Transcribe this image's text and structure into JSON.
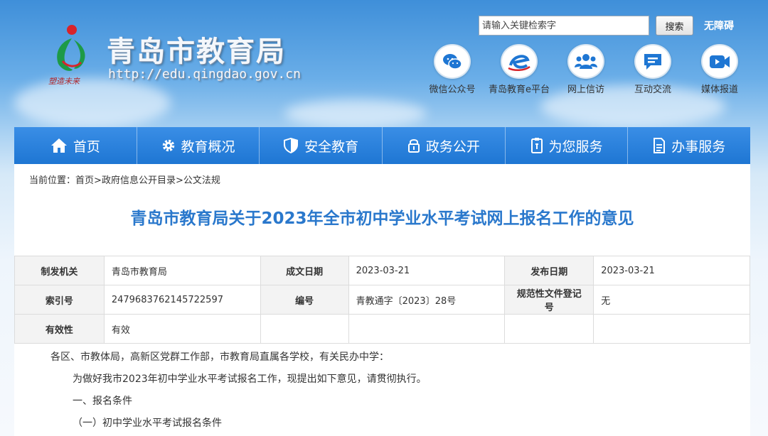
{
  "header": {
    "site_title": "青岛市教育局",
    "site_url": "http://edu.qingdao.gov.cn",
    "logo_caption": "塑造未来",
    "search_placeholder": "请输入关键检索字",
    "search_button": "搜索",
    "accessibility": "无障碍",
    "quick_links": [
      {
        "label": "微信公众号",
        "icon": "wechat-icon"
      },
      {
        "label": "青岛教育e平台",
        "icon": "e-platform-icon"
      },
      {
        "label": "网上信访",
        "icon": "petition-icon"
      },
      {
        "label": "互动交流",
        "icon": "chat-icon"
      },
      {
        "label": "媒体报道",
        "icon": "video-icon"
      }
    ]
  },
  "nav": {
    "items": [
      {
        "label": "首页",
        "icon": "home-icon"
      },
      {
        "label": "教育概况",
        "icon": "gear-icon"
      },
      {
        "label": "安全教育",
        "icon": "shield-icon"
      },
      {
        "label": "政务公开",
        "icon": "lock-icon"
      },
      {
        "label": "为您服务",
        "icon": "document-icon"
      },
      {
        "label": "办事服务",
        "icon": "file-icon"
      }
    ]
  },
  "breadcrumb": {
    "prefix": "当前位置：",
    "items": [
      "首页",
      "政府信息公开目录",
      "公文法规"
    ],
    "separator": ">"
  },
  "document": {
    "title": "青岛市教育局关于2023年全市初中学业水平考试网上报名工作的意见",
    "meta": {
      "issuer_label": "制发机关",
      "issuer": "青岛市教育局",
      "written_date_label": "成文日期",
      "written_date": "2023-03-21",
      "publish_date_label": "发布日期",
      "publish_date": "2023-03-21",
      "index_label": "索引号",
      "index": "2479683762145722597",
      "number_label": "编号",
      "number": "青教通字〔2023〕28号",
      "registration_label": "规范性文件登记号",
      "registration": "无",
      "validity_label": "有效性",
      "validity": "有效"
    },
    "paragraphs": [
      "各区、市教体局，高新区党群工作部，市教育局直属各学校，有关民办中学：",
      "为做好我市2023年初中学业水平考试报名工作，现提出如下意见，请贯彻执行。",
      "一、报名条件",
      "（一）初中学业水平考试报名条件"
    ]
  },
  "colors": {
    "nav_blue": "#1e76d3",
    "title_blue": "#2a78cc"
  }
}
